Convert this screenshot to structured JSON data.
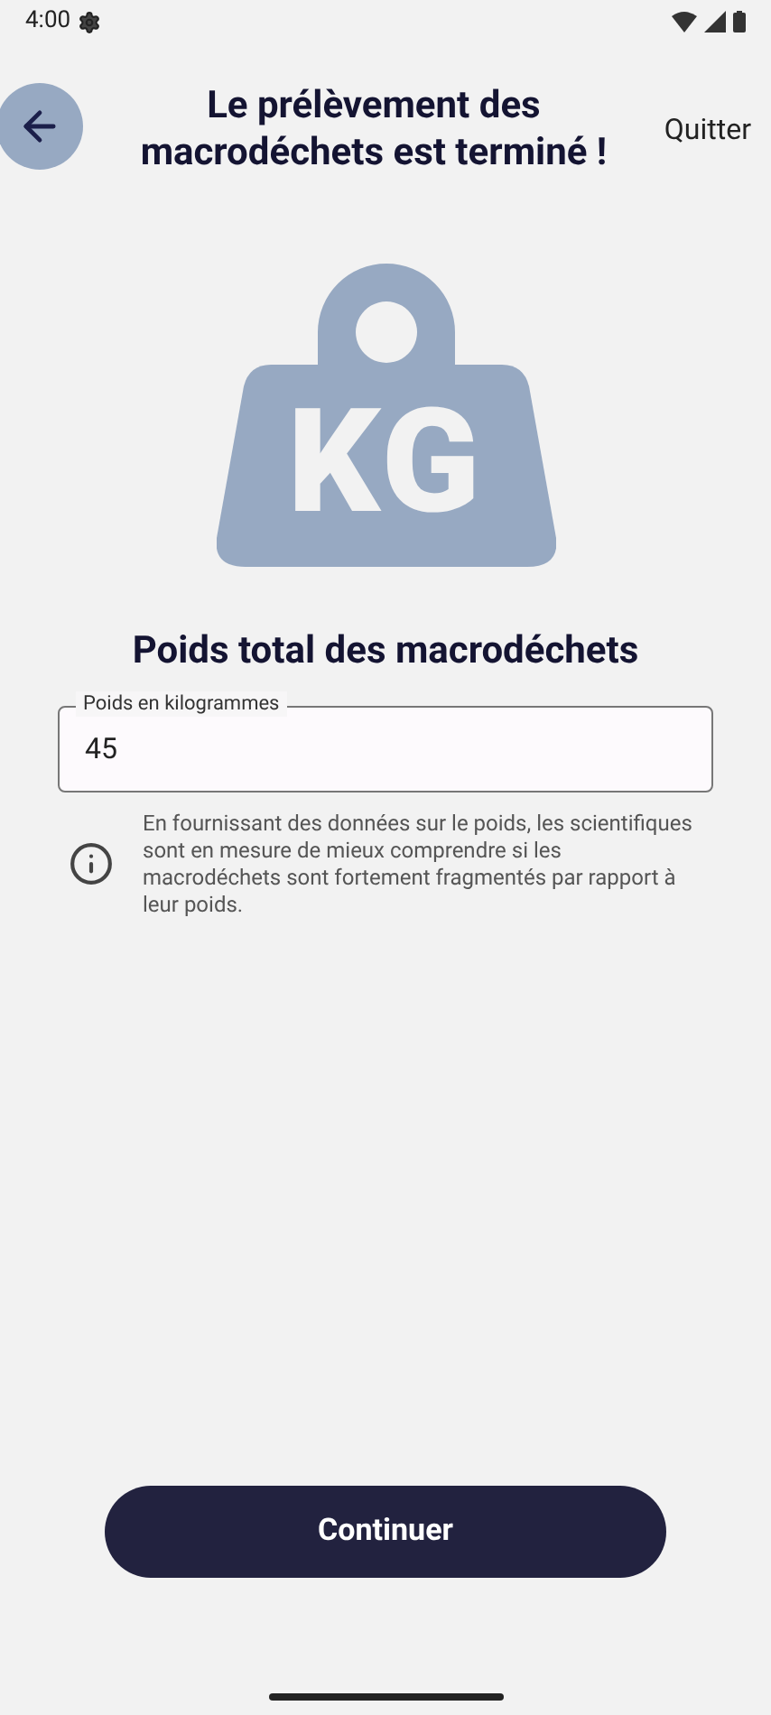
{
  "status_bar": {
    "time": "4:00"
  },
  "header": {
    "title": "Le prélèvement des macrodéchets est terminé !",
    "action": "Quitter"
  },
  "weight_badge": {
    "text": "KG"
  },
  "section_title": "Poids total des macrodéchets",
  "weight_field": {
    "label": "Poids en kilogrammes",
    "value": "45"
  },
  "info": "En fournissant des données sur le poids, les scientifiques sont en mesure de mieux comprendre si les macrodéchets sont fortement fragmentés par rapport à leur poids.",
  "continue_button": "Continuer"
}
